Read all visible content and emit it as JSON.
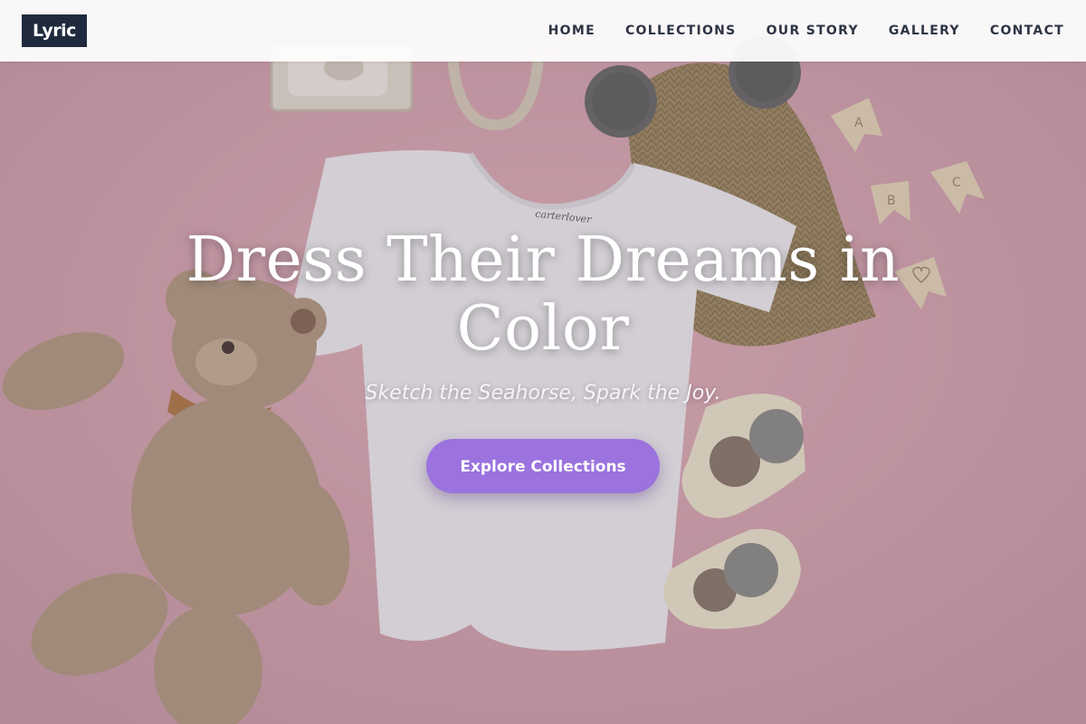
{
  "header": {
    "logo_text": "Lyric",
    "nav": [
      {
        "label": "HOME"
      },
      {
        "label": "COLLECTIONS"
      },
      {
        "label": "OUR STORY"
      },
      {
        "label": "GALLERY"
      },
      {
        "label": "CONTACT"
      }
    ]
  },
  "hero": {
    "title": "Dress Their Dreams in Color",
    "subtitle": "Sketch the Seahorse, Spark the Joy.",
    "cta_label": "Explore Collections",
    "tshirt_tag": "carterlover",
    "banner_letters": [
      "A",
      "B",
      "C"
    ]
  },
  "colors": {
    "background_pink": "#d9a6ae",
    "logo_bg": "#1f2a3d",
    "nav_text": "#2d3444",
    "cta_bg": "#9b72de",
    "text_white": "#ffffff"
  },
  "icons": {
    "hero_image": "baby-clothes-flatlay-image",
    "teddy": "teddy-bear-image",
    "beanie": "knit-beanie-image",
    "socks": "baby-socks-image"
  }
}
